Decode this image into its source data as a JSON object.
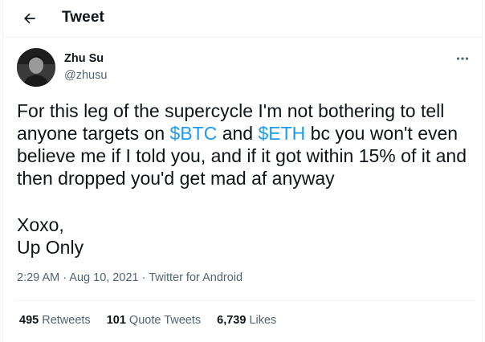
{
  "header": {
    "back_icon": "arrow-left-icon",
    "title": "Tweet"
  },
  "author": {
    "name": "Zhu Su",
    "handle": "@zhusu",
    "more_icon": "more-horizontal-icon"
  },
  "tweet": {
    "text_part1": "For this leg of the supercycle I'm not bothering to tell anyone targets on ",
    "cashtag1": "$BTC",
    "text_part2": " and ",
    "cashtag2": "$ETH",
    "text_part3": " bc you won't even believe me if I told you, and if it got within 15% of it and then dropped you'd get mad af anyway",
    "signoff_line1": "Xoxo,",
    "signoff_line2": "Up Only"
  },
  "meta": {
    "time": "2:29 AM",
    "sep1": " · ",
    "date": "Aug 10, 2021",
    "sep2": " · ",
    "source": "Twitter for Android"
  },
  "stats": {
    "retweets_count": "495",
    "retweets_label": "Retweets",
    "quote_count": "101",
    "quote_label": "Quote Tweets",
    "likes_count": "6,739",
    "likes_label": "Likes"
  },
  "colors": {
    "accent": "#1d9bf0",
    "text": "#0f1419",
    "secondary": "#536471",
    "border": "#eff3f4"
  }
}
